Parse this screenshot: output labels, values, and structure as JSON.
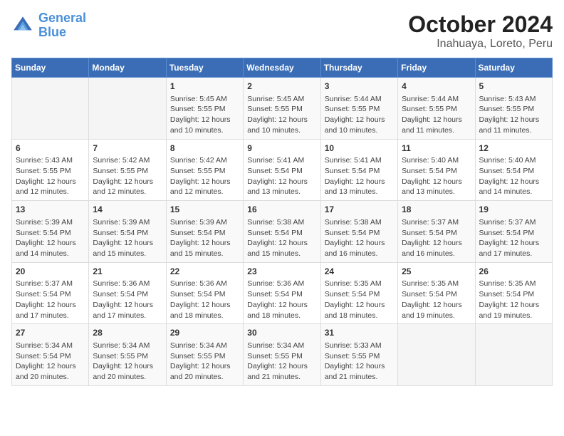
{
  "header": {
    "logo_line1": "General",
    "logo_line2": "Blue",
    "title": "October 2024",
    "subtitle": "Inahuaya, Loreto, Peru"
  },
  "calendar": {
    "days_of_week": [
      "Sunday",
      "Monday",
      "Tuesday",
      "Wednesday",
      "Thursday",
      "Friday",
      "Saturday"
    ],
    "weeks": [
      [
        {
          "day": "",
          "detail": ""
        },
        {
          "day": "",
          "detail": ""
        },
        {
          "day": "1",
          "detail": "Sunrise: 5:45 AM\nSunset: 5:55 PM\nDaylight: 12 hours\nand 10 minutes."
        },
        {
          "day": "2",
          "detail": "Sunrise: 5:45 AM\nSunset: 5:55 PM\nDaylight: 12 hours\nand 10 minutes."
        },
        {
          "day": "3",
          "detail": "Sunrise: 5:44 AM\nSunset: 5:55 PM\nDaylight: 12 hours\nand 10 minutes."
        },
        {
          "day": "4",
          "detail": "Sunrise: 5:44 AM\nSunset: 5:55 PM\nDaylight: 12 hours\nand 11 minutes."
        },
        {
          "day": "5",
          "detail": "Sunrise: 5:43 AM\nSunset: 5:55 PM\nDaylight: 12 hours\nand 11 minutes."
        }
      ],
      [
        {
          "day": "6",
          "detail": "Sunrise: 5:43 AM\nSunset: 5:55 PM\nDaylight: 12 hours\nand 12 minutes."
        },
        {
          "day": "7",
          "detail": "Sunrise: 5:42 AM\nSunset: 5:55 PM\nDaylight: 12 hours\nand 12 minutes."
        },
        {
          "day": "8",
          "detail": "Sunrise: 5:42 AM\nSunset: 5:55 PM\nDaylight: 12 hours\nand 12 minutes."
        },
        {
          "day": "9",
          "detail": "Sunrise: 5:41 AM\nSunset: 5:54 PM\nDaylight: 12 hours\nand 13 minutes."
        },
        {
          "day": "10",
          "detail": "Sunrise: 5:41 AM\nSunset: 5:54 PM\nDaylight: 12 hours\nand 13 minutes."
        },
        {
          "day": "11",
          "detail": "Sunrise: 5:40 AM\nSunset: 5:54 PM\nDaylight: 12 hours\nand 13 minutes."
        },
        {
          "day": "12",
          "detail": "Sunrise: 5:40 AM\nSunset: 5:54 PM\nDaylight: 12 hours\nand 14 minutes."
        }
      ],
      [
        {
          "day": "13",
          "detail": "Sunrise: 5:39 AM\nSunset: 5:54 PM\nDaylight: 12 hours\nand 14 minutes."
        },
        {
          "day": "14",
          "detail": "Sunrise: 5:39 AM\nSunset: 5:54 PM\nDaylight: 12 hours\nand 15 minutes."
        },
        {
          "day": "15",
          "detail": "Sunrise: 5:39 AM\nSunset: 5:54 PM\nDaylight: 12 hours\nand 15 minutes."
        },
        {
          "day": "16",
          "detail": "Sunrise: 5:38 AM\nSunset: 5:54 PM\nDaylight: 12 hours\nand 15 minutes."
        },
        {
          "day": "17",
          "detail": "Sunrise: 5:38 AM\nSunset: 5:54 PM\nDaylight: 12 hours\nand 16 minutes."
        },
        {
          "day": "18",
          "detail": "Sunrise: 5:37 AM\nSunset: 5:54 PM\nDaylight: 12 hours\nand 16 minutes."
        },
        {
          "day": "19",
          "detail": "Sunrise: 5:37 AM\nSunset: 5:54 PM\nDaylight: 12 hours\nand 17 minutes."
        }
      ],
      [
        {
          "day": "20",
          "detail": "Sunrise: 5:37 AM\nSunset: 5:54 PM\nDaylight: 12 hours\nand 17 minutes."
        },
        {
          "day": "21",
          "detail": "Sunrise: 5:36 AM\nSunset: 5:54 PM\nDaylight: 12 hours\nand 17 minutes."
        },
        {
          "day": "22",
          "detail": "Sunrise: 5:36 AM\nSunset: 5:54 PM\nDaylight: 12 hours\nand 18 minutes."
        },
        {
          "day": "23",
          "detail": "Sunrise: 5:36 AM\nSunset: 5:54 PM\nDaylight: 12 hours\nand 18 minutes."
        },
        {
          "day": "24",
          "detail": "Sunrise: 5:35 AM\nSunset: 5:54 PM\nDaylight: 12 hours\nand 18 minutes."
        },
        {
          "day": "25",
          "detail": "Sunrise: 5:35 AM\nSunset: 5:54 PM\nDaylight: 12 hours\nand 19 minutes."
        },
        {
          "day": "26",
          "detail": "Sunrise: 5:35 AM\nSunset: 5:54 PM\nDaylight: 12 hours\nand 19 minutes."
        }
      ],
      [
        {
          "day": "27",
          "detail": "Sunrise: 5:34 AM\nSunset: 5:54 PM\nDaylight: 12 hours\nand 20 minutes."
        },
        {
          "day": "28",
          "detail": "Sunrise: 5:34 AM\nSunset: 5:55 PM\nDaylight: 12 hours\nand 20 minutes."
        },
        {
          "day": "29",
          "detail": "Sunrise: 5:34 AM\nSunset: 5:55 PM\nDaylight: 12 hours\nand 20 minutes."
        },
        {
          "day": "30",
          "detail": "Sunrise: 5:34 AM\nSunset: 5:55 PM\nDaylight: 12 hours\nand 21 minutes."
        },
        {
          "day": "31",
          "detail": "Sunrise: 5:33 AM\nSunset: 5:55 PM\nDaylight: 12 hours\nand 21 minutes."
        },
        {
          "day": "",
          "detail": ""
        },
        {
          "day": "",
          "detail": ""
        }
      ]
    ]
  }
}
